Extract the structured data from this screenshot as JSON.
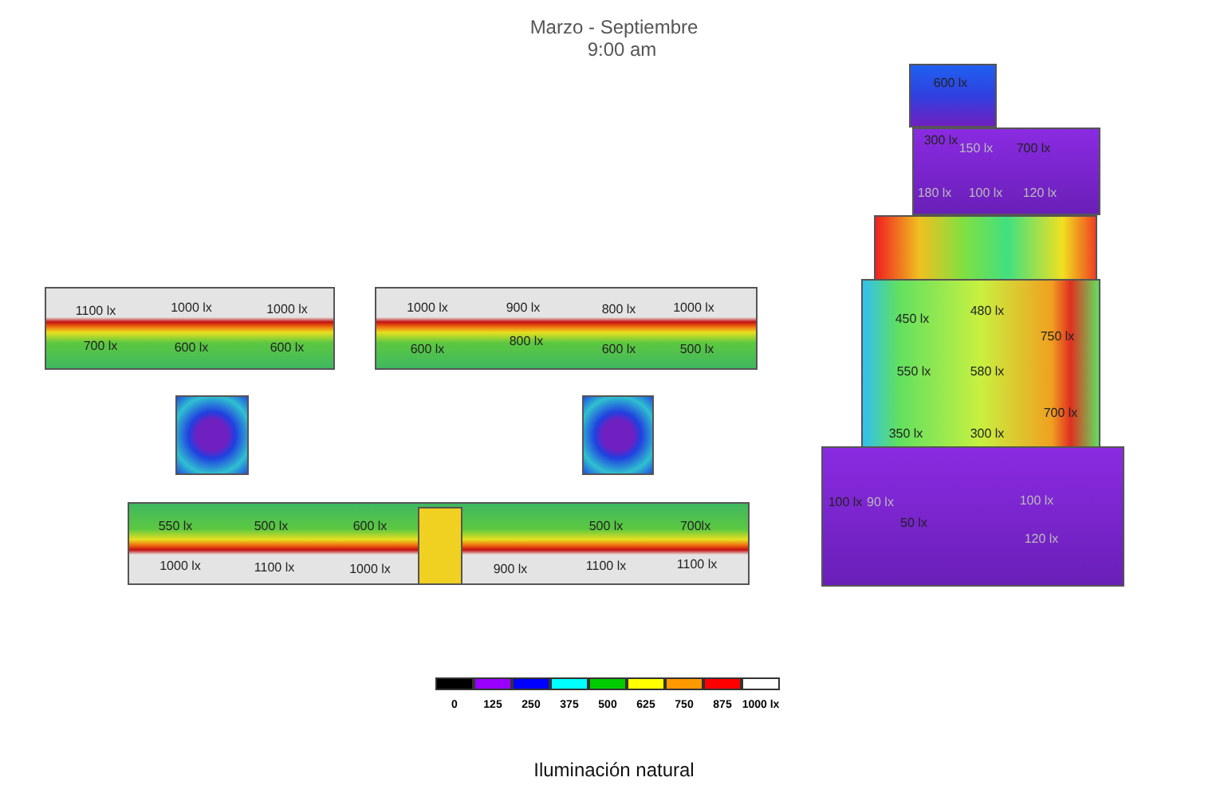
{
  "title": "Marzo - Septiembre",
  "subtitle": "9:00 am",
  "plans": [
    {
      "labels": [
        "1100 lx",
        "700 lx",
        "1000 lx",
        "600 lx",
        "1000 lx",
        "600 lx"
      ]
    },
    {
      "labels": [
        "1000 lx",
        "600 lx",
        "900 lx",
        "800 lx",
        "800 lx",
        "600 lx",
        "1000 lx",
        "500 lx"
      ]
    },
    {
      "labels": [
        "550 lx",
        "1000 lx",
        "500 lx",
        "1100 lx",
        "600 lx",
        "1000 lx",
        "900 lx",
        "500 lx",
        "1100 lx",
        "700lx",
        "1100 lx"
      ]
    },
    {
      "labels": [
        "600 lx",
        "300 lx",
        "150 lx",
        "700 lx",
        "180 lx",
        "100 lx",
        "120 lx",
        "480 lx",
        "450 lx",
        "750 lx",
        "550 lx",
        "580 lx",
        "700 lx",
        "350 lx",
        "300 lx",
        "100 lx",
        "90 lx",
        "100 lx",
        "50 lx",
        "120 lx"
      ]
    }
  ],
  "legend": [
    {
      "label": "0",
      "color": "#000000"
    },
    {
      "label": "125",
      "color": "#9900ff"
    },
    {
      "label": "250",
      "color": "#0000ff"
    },
    {
      "label": "375",
      "color": "#00ffff"
    },
    {
      "label": "500",
      "color": "#00cc00"
    },
    {
      "label": "625",
      "color": "#ffff00"
    },
    {
      "label": "750",
      "color": "#ff9900"
    },
    {
      "label": "875",
      "color": "#ff0000"
    },
    {
      "label": "1000 lx",
      "color": "#ffffff"
    }
  ],
  "caption": "Iluminación natural"
}
